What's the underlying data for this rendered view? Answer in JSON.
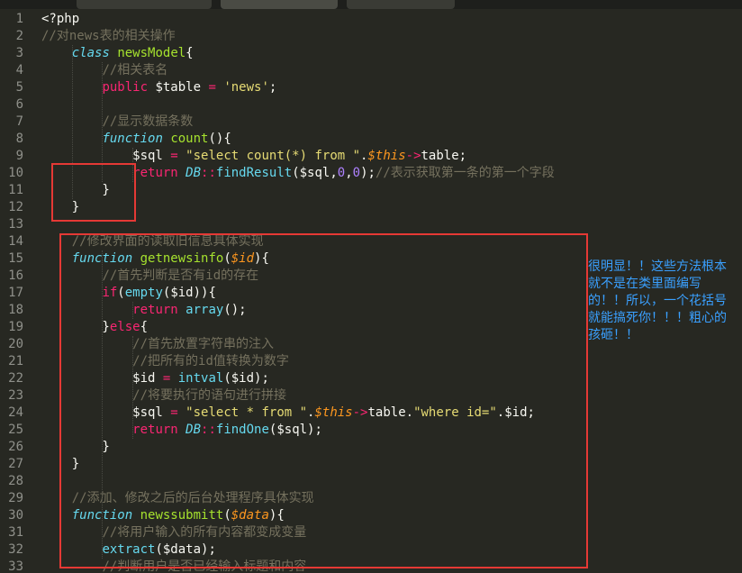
{
  "colors": {
    "background": "#272822",
    "comment": "#75715e",
    "keyword": "#f92672",
    "storage": "#66d9ef",
    "function_name": "#a6e22e",
    "string": "#e6db74",
    "number": "#ae81ff",
    "param": "#fd971f",
    "annotation_text": "#3aa0ff",
    "box": "#e53935"
  },
  "lines": [
    {
      "n": "1",
      "tokens": [
        {
          "t": "<?php",
          "c": "plain"
        }
      ]
    },
    {
      "n": "2",
      "tokens": [
        {
          "t": "//对news表的相关操作",
          "c": "comment"
        }
      ]
    },
    {
      "n": "3",
      "tokens": [
        {
          "t": "    "
        },
        {
          "t": "class",
          "c": "storage-i"
        },
        {
          "t": " "
        },
        {
          "t": "newsModel",
          "c": "fn"
        },
        {
          "t": "{"
        }
      ]
    },
    {
      "n": "4",
      "tokens": [
        {
          "t": "        "
        },
        {
          "t": "//相关表名",
          "c": "comment"
        }
      ]
    },
    {
      "n": "5",
      "tokens": [
        {
          "t": "        "
        },
        {
          "t": "public",
          "c": "kw"
        },
        {
          "t": " $table "
        },
        {
          "t": "=",
          "c": "kw"
        },
        {
          "t": " "
        },
        {
          "t": "'news'",
          "c": "str"
        },
        {
          "t": ";"
        }
      ]
    },
    {
      "n": "6",
      "tokens": []
    },
    {
      "n": "7",
      "tokens": [
        {
          "t": "        "
        },
        {
          "t": "//显示数据条数",
          "c": "comment"
        }
      ]
    },
    {
      "n": "8",
      "tokens": [
        {
          "t": "        "
        },
        {
          "t": "function",
          "c": "storage-i"
        },
        {
          "t": " "
        },
        {
          "t": "count",
          "c": "fn"
        },
        {
          "t": "(){"
        }
      ]
    },
    {
      "n": "9",
      "tokens": [
        {
          "t": "            $sql "
        },
        {
          "t": "=",
          "c": "kw"
        },
        {
          "t": " "
        },
        {
          "t": "\"select count(*) from \"",
          "c": "str"
        },
        {
          "t": "."
        },
        {
          "t": "$this",
          "c": "param-i"
        },
        {
          "t": "->",
          "c": "kw"
        },
        {
          "t": "table;"
        }
      ]
    },
    {
      "n": "10",
      "tokens": [
        {
          "t": "            "
        },
        {
          "t": "return",
          "c": "kw"
        },
        {
          "t": " "
        },
        {
          "t": "DB",
          "c": "storage-i"
        },
        {
          "t": "::",
          "c": "kw"
        },
        {
          "t": "findResult",
          "c": "storage"
        },
        {
          "t": "($sql,"
        },
        {
          "t": "0",
          "c": "num"
        },
        {
          "t": ","
        },
        {
          "t": "0",
          "c": "num"
        },
        {
          "t": ");"
        },
        {
          "t": "//表示获取第一条的第一个字段",
          "c": "comment"
        }
      ]
    },
    {
      "n": "11",
      "tokens": [
        {
          "t": "        }"
        }
      ]
    },
    {
      "n": "12",
      "tokens": [
        {
          "t": "    }"
        }
      ]
    },
    {
      "n": "13",
      "tokens": []
    },
    {
      "n": "14",
      "tokens": [
        {
          "t": "    "
        },
        {
          "t": "//修改界面的读取旧信息具体实现",
          "c": "comment"
        }
      ]
    },
    {
      "n": "15",
      "tokens": [
        {
          "t": "    "
        },
        {
          "t": "function",
          "c": "storage-i"
        },
        {
          "t": " "
        },
        {
          "t": "getnewsinfo",
          "c": "fn"
        },
        {
          "t": "("
        },
        {
          "t": "$id",
          "c": "param-i"
        },
        {
          "t": "){"
        }
      ]
    },
    {
      "n": "16",
      "tokens": [
        {
          "t": "        "
        },
        {
          "t": "//首先判断是否有id的存在",
          "c": "comment"
        }
      ]
    },
    {
      "n": "17",
      "tokens": [
        {
          "t": "        "
        },
        {
          "t": "if",
          "c": "kw"
        },
        {
          "t": "("
        },
        {
          "t": "empty",
          "c": "storage"
        },
        {
          "t": "($id)){"
        }
      ]
    },
    {
      "n": "18",
      "tokens": [
        {
          "t": "            "
        },
        {
          "t": "return",
          "c": "kw"
        },
        {
          "t": " "
        },
        {
          "t": "array",
          "c": "storage"
        },
        {
          "t": "();"
        }
      ]
    },
    {
      "n": "19",
      "tokens": [
        {
          "t": "        }"
        },
        {
          "t": "else",
          "c": "kw"
        },
        {
          "t": "{"
        }
      ]
    },
    {
      "n": "20",
      "tokens": [
        {
          "t": "            "
        },
        {
          "t": "//首先放置字符串的注入",
          "c": "comment"
        }
      ]
    },
    {
      "n": "21",
      "tokens": [
        {
          "t": "            "
        },
        {
          "t": "//把所有的id值转换为数字",
          "c": "comment"
        }
      ]
    },
    {
      "n": "22",
      "tokens": [
        {
          "t": "            $id "
        },
        {
          "t": "=",
          "c": "kw"
        },
        {
          "t": " "
        },
        {
          "t": "intval",
          "c": "storage"
        },
        {
          "t": "($id);"
        }
      ]
    },
    {
      "n": "23",
      "tokens": [
        {
          "t": "            "
        },
        {
          "t": "//将要执行的语句进行拼接",
          "c": "comment"
        }
      ]
    },
    {
      "n": "24",
      "tokens": [
        {
          "t": "            $sql "
        },
        {
          "t": "=",
          "c": "kw"
        },
        {
          "t": " "
        },
        {
          "t": "\"select * from \"",
          "c": "str"
        },
        {
          "t": "."
        },
        {
          "t": "$this",
          "c": "param-i"
        },
        {
          "t": "->",
          "c": "kw"
        },
        {
          "t": "table."
        },
        {
          "t": "\"where id=\"",
          "c": "str"
        },
        {
          "t": ".$id;"
        }
      ]
    },
    {
      "n": "25",
      "tokens": [
        {
          "t": "            "
        },
        {
          "t": "return",
          "c": "kw"
        },
        {
          "t": " "
        },
        {
          "t": "DB",
          "c": "storage-i"
        },
        {
          "t": "::",
          "c": "kw"
        },
        {
          "t": "findOne",
          "c": "storage"
        },
        {
          "t": "($sql);"
        }
      ]
    },
    {
      "n": "26",
      "tokens": [
        {
          "t": "        }"
        }
      ]
    },
    {
      "n": "27",
      "tokens": [
        {
          "t": "    }"
        }
      ]
    },
    {
      "n": "28",
      "tokens": []
    },
    {
      "n": "29",
      "tokens": [
        {
          "t": "    "
        },
        {
          "t": "//添加、修改之后的后台处理程序具体实现",
          "c": "comment"
        }
      ]
    },
    {
      "n": "30",
      "tokens": [
        {
          "t": "    "
        },
        {
          "t": "function",
          "c": "storage-i"
        },
        {
          "t": " "
        },
        {
          "t": "newssubmitt",
          "c": "fn"
        },
        {
          "t": "("
        },
        {
          "t": "$data",
          "c": "param-i"
        },
        {
          "t": "){"
        }
      ]
    },
    {
      "n": "31",
      "tokens": [
        {
          "t": "        "
        },
        {
          "t": "//将用户输入的所有内容都变成变量",
          "c": "comment"
        }
      ]
    },
    {
      "n": "32",
      "tokens": [
        {
          "t": "        "
        },
        {
          "t": "extract",
          "c": "storage"
        },
        {
          "t": "($data);"
        }
      ]
    },
    {
      "n": "33",
      "tokens": [
        {
          "t": "        "
        },
        {
          "t": "//判断用户是否已经输入标题和内容",
          "c": "comment"
        }
      ]
    }
  ],
  "annotation": "很明显！！这些方法根本就不是在类里面编写的！！所以，一个花括号就能搞死你！！！粗心的孩砸！！"
}
